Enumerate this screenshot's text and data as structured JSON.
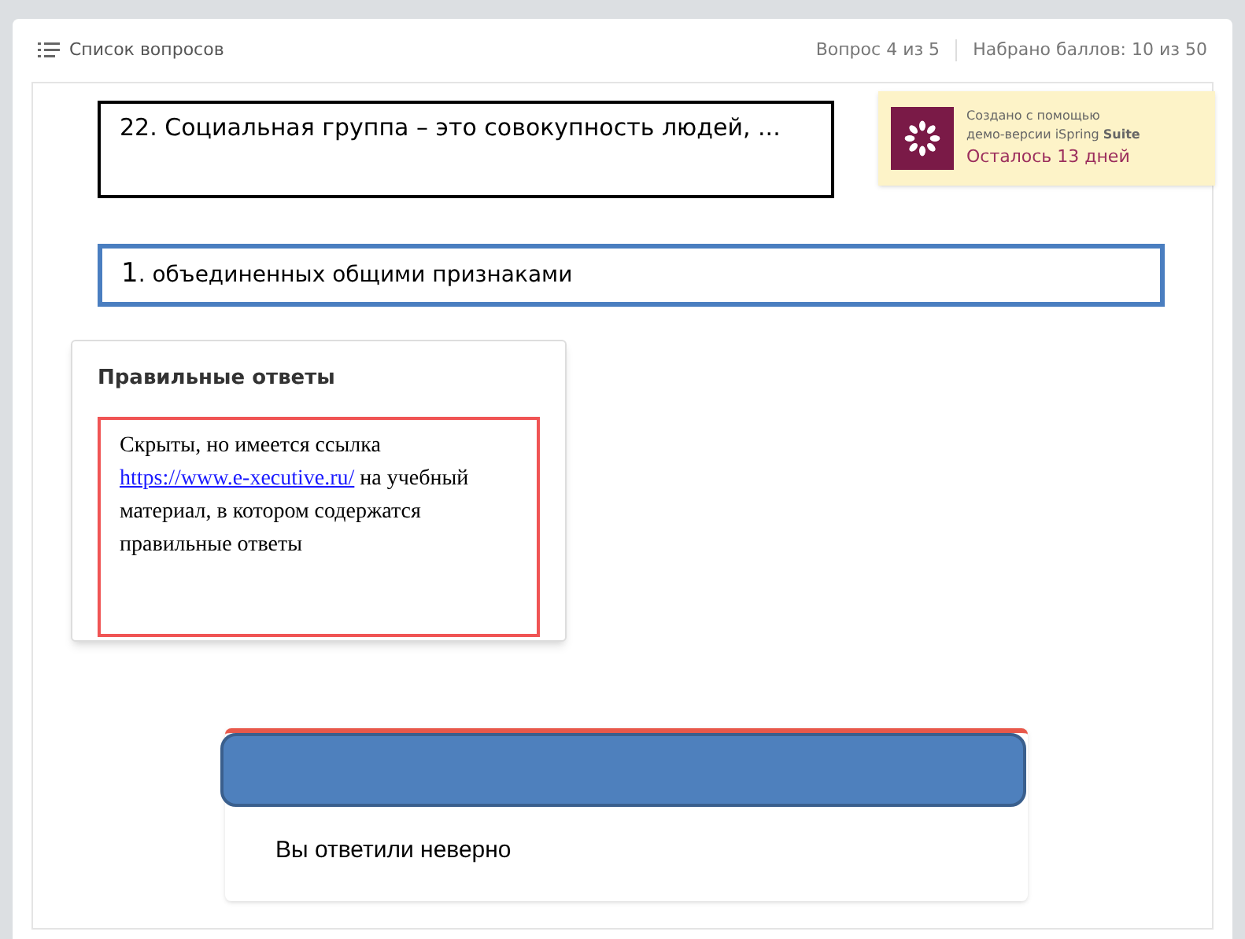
{
  "header": {
    "list_label": "Список вопросов",
    "question_counter": "Вопрос 4 из 5",
    "score": "Набрано баллов: 10 из 50"
  },
  "question": {
    "text": "22. Социальная группа – это совокупность людей, ..."
  },
  "watermark": {
    "line_1": "Создано с помощью",
    "line_2": "демо-версии iSpring **Suite**",
    "days_left": "Осталось 13 дней"
  },
  "answer": {
    "number": "1",
    "text": ". объединенных общими признаками"
  },
  "correct_answers": {
    "title": "Правильные ответы",
    "text_before": "Скрыты, но имеется ссылка",
    "link": "https://www.e-xecutive.ru/",
    "text_after": "на учебный материал, в котором содержатся правильные ответы"
  },
  "feedback": {
    "text": "Вы ответили неверно"
  }
}
